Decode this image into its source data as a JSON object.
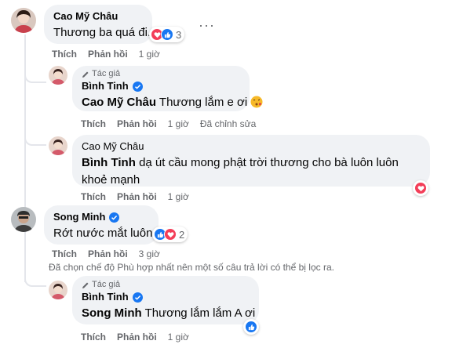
{
  "colors": {
    "like_blue": "#1877f2",
    "love_red": "#f33e58",
    "text_secondary": "#65676b",
    "bubble_bg": "#f0f2f5"
  },
  "actions": {
    "like": "Thích",
    "reply": "Phản hồi",
    "edited": "Đã chỉnh sửa"
  },
  "author_badge": "Tác giả",
  "comments": [
    {
      "author": "Cao Mỹ Châu",
      "text": "Thương ba quá đi.",
      "time": "1 giờ",
      "reactions": [
        "heart-icon",
        "like-icon"
      ],
      "reaction_count": "3",
      "more_icon": "more-options-icon",
      "replies": [
        {
          "author": "Bình Tinh",
          "is_author": true,
          "verified": true,
          "tag": "Cao Mỹ Châu",
          "text": "Thương lắm e ơi",
          "emoji": "kissing-face-icon",
          "time": "1 giờ",
          "edited": true
        },
        {
          "author": "Cao Mỹ Châu",
          "tag": "Bình Tinh",
          "text_line1": "dạ út cầu mong phật trời thương cho bà luôn luôn",
          "text_line2": "khoẻ mạnh",
          "time": "1 giờ",
          "reactions": [
            "heart-icon"
          ]
        }
      ]
    },
    {
      "author": "Song Minh",
      "verified": true,
      "text": "Rớt nước mắt luôn",
      "time": "3 giờ",
      "reactions": [
        "like-icon",
        "heart-icon"
      ],
      "reaction_count": "2",
      "filter_notice": "Đã chọn chế độ Phù hợp nhất nên một số câu trả lời có thể bị lọc ra.",
      "replies": [
        {
          "author": "Bình Tinh",
          "is_author": true,
          "verified": true,
          "tag": "Song Minh",
          "text": "Thương lắm lắm A ơi",
          "time": "1 giờ",
          "reactions": [
            "like-icon"
          ]
        }
      ]
    }
  ]
}
